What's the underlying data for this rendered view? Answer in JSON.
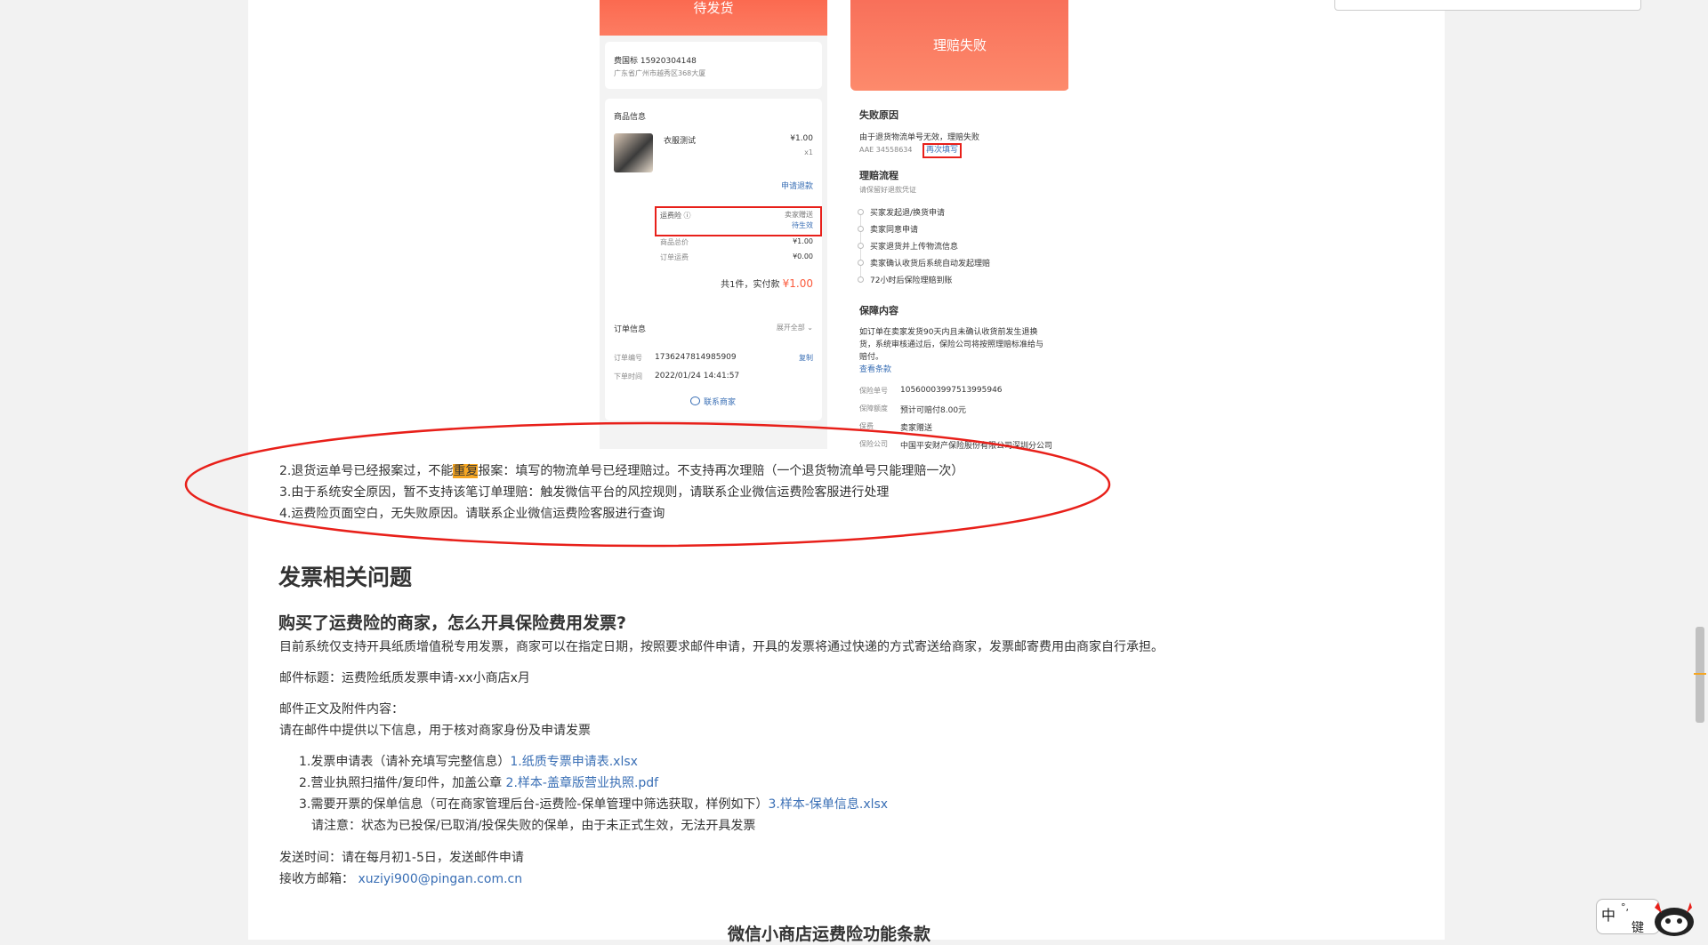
{
  "left_phone": {
    "status": "待发货",
    "address_name": "费国标 15920304148",
    "address_detail": "广东省广州市越秀区368大厦",
    "goods_title": "商品信息",
    "goods_name": "衣服测试",
    "goods_price": "¥1.00",
    "goods_qty": "x1",
    "refund_link": "申请退款",
    "freight_ins_label": "运费险 ⓘ",
    "freight_ins_value": "卖家赠送",
    "freight_ins_status": "待生效",
    "goods_total_label": "商品总价",
    "goods_total_value": "¥1.00",
    "shipping_label": "订单运费",
    "shipping_value": "¥0.00",
    "total_prefix": "共1件，实付款",
    "total_value": "¥1.00",
    "order_title": "订单信息",
    "expand": "展开全部 ⌄",
    "order_no_label": "订单编号",
    "order_no_value": "1736247814985909",
    "copy": "复制",
    "order_time_label": "下单时间",
    "order_time_value": "2022/01/24 14:41:57",
    "contact": "联系商家"
  },
  "right_phone": {
    "status": "理赔失败",
    "fail_title": "失败原因",
    "fail_reason": "由于退货物流单号无效，理赔失败",
    "fail_tracking": "AAE 34558634",
    "refill": "再次填写",
    "flow_title": "理赔流程",
    "flow_sub": "请保留好退款凭证",
    "flow_steps": [
      "买家发起退/换货申请",
      "卖家同意申请",
      "买家退货并上传物流信息",
      "卖家确认收货后系统自动发起理赔",
      "72小时后保险理赔到账"
    ],
    "coverage_title": "保障内容",
    "coverage_text_1": "如订单在卖家发货90天内且未确认收货前发生退换",
    "coverage_text_2": "货，系统审核通过后，保险公司将按照理赔标准给与",
    "coverage_text_3": "赔付。",
    "view_terms": "查看条款",
    "policy_no_label": "保险单号",
    "policy_no_value": "10560003997513995946",
    "amount_label": "保障额度",
    "amount_value": "预计可赔付8.00元",
    "premium_label": "保费",
    "premium_value": "卖家赠送",
    "company_label": "保险公司",
    "company_value": "中国平安财产保险股份有限公司深圳分公司"
  },
  "article": {
    "line2_a": "2.退货运单号已经报案过，不能",
    "line2_hl": "重复",
    "line2_b": "报案：填写的物流单号已经理赔过。不支持再次理赔（一个退货物流单号只能理赔一次）",
    "line3": "3.由于系统安全原因，暂不支持该笔订单理赔：触发微信平台的风控规则，请联系企业微信运费险客服进行处理",
    "line4": "4.运费险页面空白，无失败原因。请联系企业微信运费险客服进行查询",
    "h_invoice": "发票相关问题",
    "h_q": "购买了运费险的商家，怎么开具保险费用发票?",
    "p_intro": "目前系统仅支持开具纸质增值税专用发票，商家可以在指定日期，按照要求邮件申请，开具的发票将通过快递的方式寄送给商家，发票邮寄费用由商家自行承担。",
    "p_subject": "邮件标题：运费险纸质发票申请-xx小商店x月",
    "p_body_title": "邮件正文及附件内容：",
    "p_body_desc": "请在邮件中提供以下信息，用于核对商家身份及申请发票",
    "item1_text": "1.发票申请表（请补充填写完整信息）",
    "item1_link": "1.纸质专票申请表.xlsx",
    "item2_text": "2.营业执照扫描件/复印件，加盖公章",
    "item2_link": "2.样本-盖章版营业执照.pdf",
    "item3_text": "3.需要开票的保单信息（可在商家管理后台-运费险-保单管理中筛选获取，样例如下）",
    "item3_link": "3.样本-保单信息.xlsx",
    "note": "请注意：状态为已投保/已取消/投保失败的保单，由于未正式生效，无法开具发票",
    "send_time": "发送时间：请在每月初1-5日，发送邮件申请",
    "mail_label": "接收方邮箱：",
    "mail_value": "xuziyi900@pingan.com.cn",
    "h_terms": "微信小商店运费险功能条款"
  },
  "ime": {
    "label1": "中",
    "label2": "°,",
    "label3": "键"
  },
  "colors": {
    "accent": "#fb6a50",
    "link": "#3a6fb5",
    "annotation": "#e8201a",
    "highlight": "#f5a623"
  }
}
